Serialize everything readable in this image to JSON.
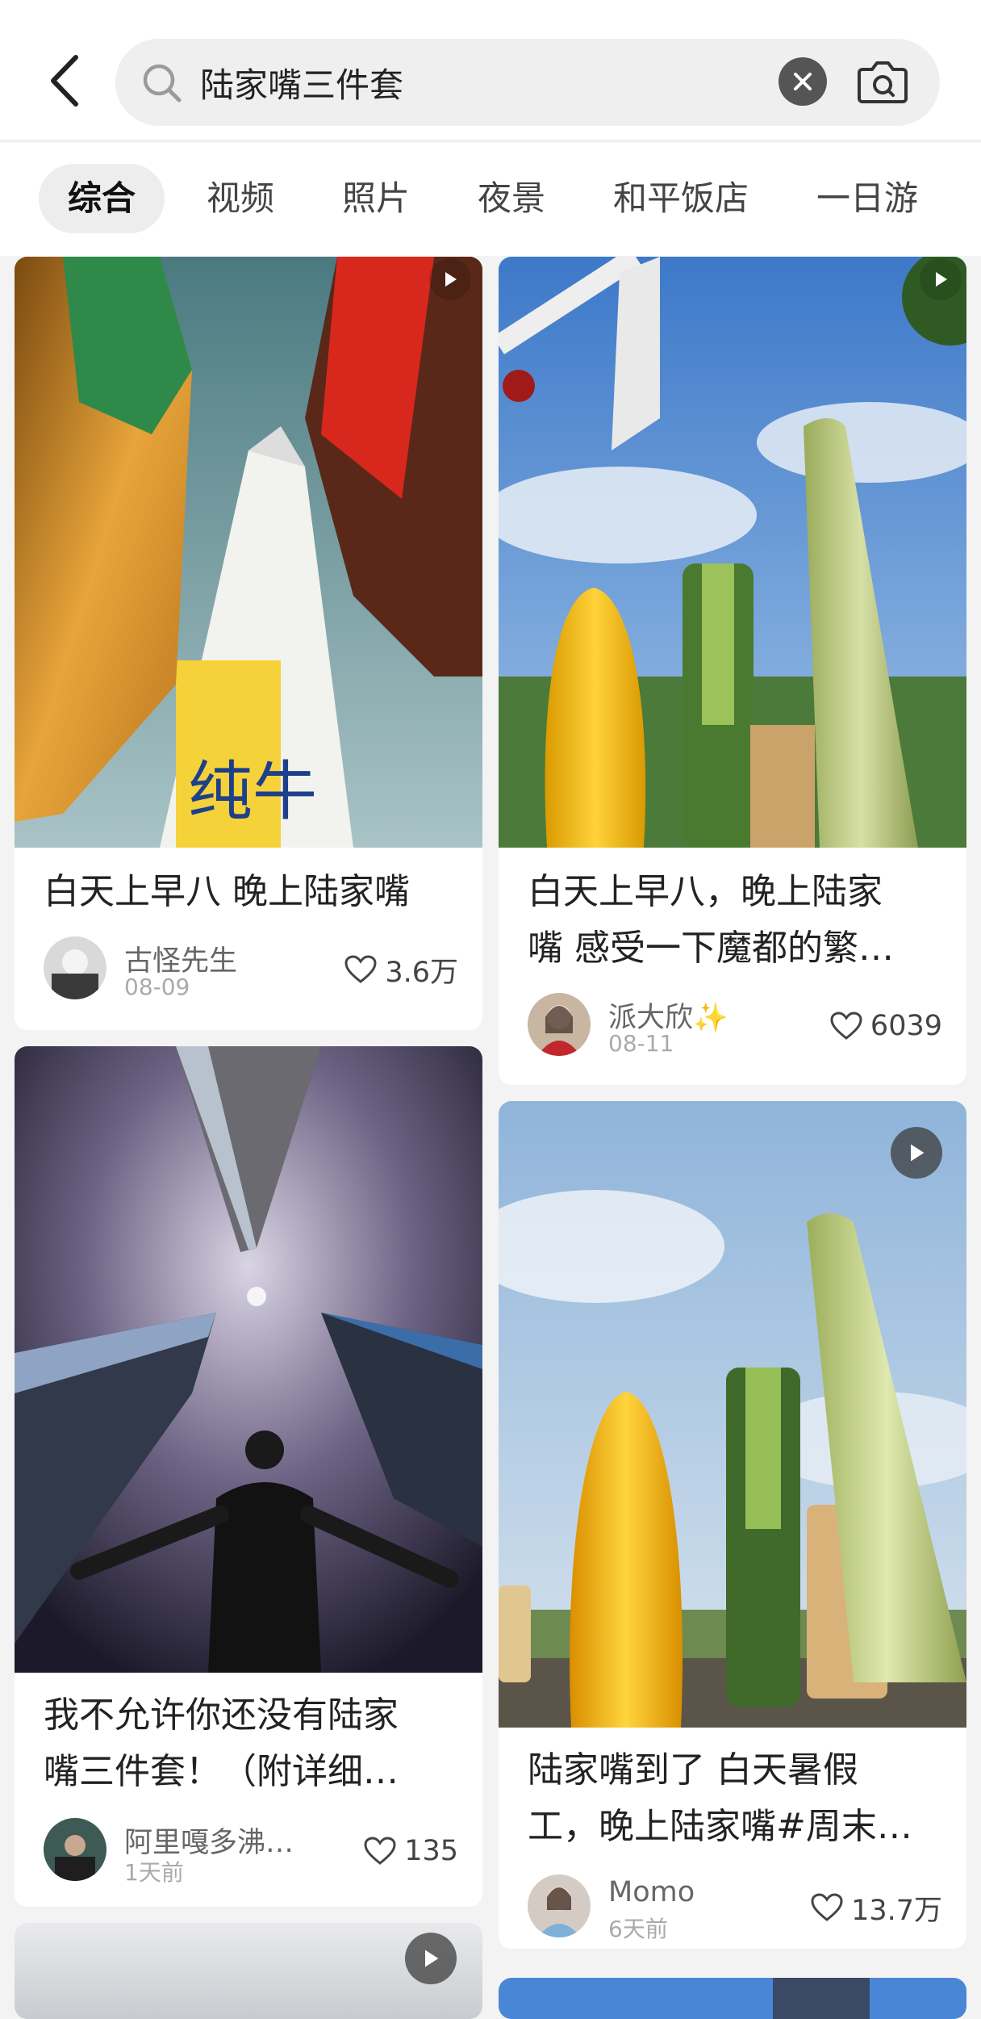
{
  "search": {
    "query": "陆家嘴三件套"
  },
  "tabs": [
    {
      "label": "综合",
      "active": true
    },
    {
      "label": "视频",
      "active": false
    },
    {
      "label": "照片",
      "active": false
    },
    {
      "label": "夜景",
      "active": false
    },
    {
      "label": "和平饭店",
      "active": false
    },
    {
      "label": "一日游",
      "active": false
    }
  ],
  "cards": [
    {
      "title": "白天上早八 晚上陆家嘴",
      "author": "古怪先生",
      "date": "08-09",
      "likes": "3.6万",
      "video": true
    },
    {
      "title_line1": "白天上早八，晚上陆家",
      "title_line2": "嘴 感受一下魔都的繁…",
      "author": "派大欣✨",
      "date": "08-11",
      "likes": "6039",
      "video": true
    },
    {
      "title_line1": "我不允许你还没有陆家",
      "title_line2": "嘴三件套！（附详细…",
      "author": "阿里嘎多沸…",
      "date": "1天前",
      "likes": "135",
      "video": false
    },
    {
      "title_line1": "陆家嘴到了 白天暑假",
      "title_line2": "工，晚上陆家嘴#周末…",
      "author": "Momo",
      "date": "6天前",
      "likes": "13.7万",
      "video": true
    }
  ],
  "colors": {
    "accent_text": "#222222",
    "muted_text": "#aaaaaa",
    "page_bg": "#f3f3f3"
  }
}
